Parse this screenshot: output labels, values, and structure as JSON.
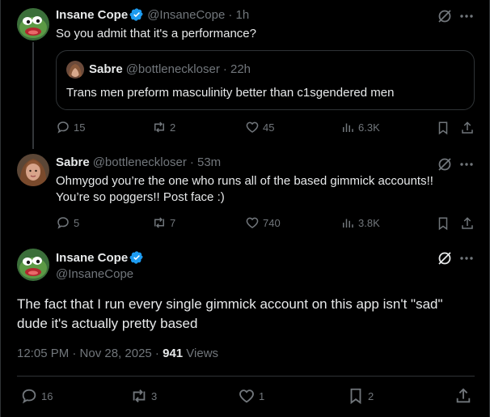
{
  "tweets": [
    {
      "name": "Insane Cope",
      "handle": "@InsaneCope",
      "time": "· 1h",
      "text": "So you admit that it's a performance?",
      "quote": {
        "name": "Sabre",
        "handle": "@bottleneckloser",
        "time": "· 22h",
        "text": "Trans men preform masculinity better than c1sgendered men"
      },
      "stats": {
        "replies": "15",
        "reposts": "2",
        "likes": "45",
        "views": "6.3K"
      }
    },
    {
      "name": "Sabre",
      "handle": "@bottleneckloser",
      "time": "· 53m",
      "text_line1": "Ohmygod you’re the one who runs all of the based gimmick accounts!!",
      "text_line2": "You’re so poggers!! Post face :)",
      "stats": {
        "replies": "5",
        "reposts": "7",
        "likes": "740",
        "views": "3.8K"
      }
    }
  ],
  "main": {
    "name": "Insane Cope",
    "handle": "@InsaneCope",
    "text_line1": "The fact that I run every single gimmick account on this app isn't \"sad\"",
    "text_line2": "dude it's actually pretty based",
    "timestamp": "12:05 PM · Nov 28, 2025 · ",
    "views_count": "941",
    "views_label": " Views",
    "stats": {
      "replies": "16",
      "reposts": "3",
      "likes": "1",
      "bookmarks": "2"
    }
  },
  "colors": {
    "verified": "#1d9bf0",
    "muted": "#71767b",
    "text": "#e7e9ea",
    "background": "#000000"
  },
  "icons": [
    "grok-icon",
    "more-icon",
    "reply-icon",
    "repost-icon",
    "like-icon",
    "views-icon",
    "bookmark-icon",
    "share-icon",
    "verified-badge-icon"
  ]
}
